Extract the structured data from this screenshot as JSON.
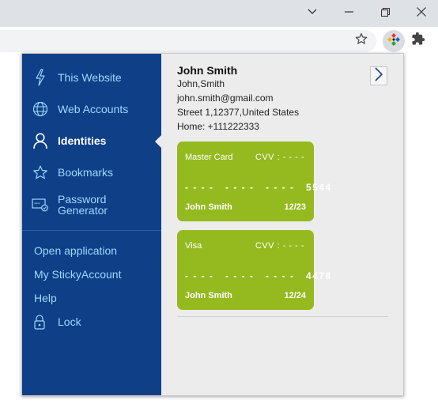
{
  "browser": {
    "window_controls": {
      "chevron": "chevron-down-icon",
      "minimize": "minimize-icon",
      "restore": "restore-icon",
      "close": "close-icon"
    },
    "toolbar": {
      "bookmark_icon": "star-icon",
      "extension_icon": "stickypassword-icon",
      "extensions_icon": "puzzle-icon"
    }
  },
  "popup": {
    "sidebar": {
      "items": [
        {
          "label": "This Website",
          "icon": "lightning-icon"
        },
        {
          "label": "Web Accounts",
          "icon": "globe-icon"
        },
        {
          "label": "Identities",
          "icon": "person-icon",
          "active": true
        },
        {
          "label": "Bookmarks",
          "icon": "star-icon"
        },
        {
          "label": "Password Generator",
          "line1": "Password",
          "line2": "Generator",
          "icon": "password-generator-icon"
        }
      ],
      "links": {
        "open_application": "Open application",
        "my_account": "My StickyAccount",
        "help": "Help",
        "lock": "Lock"
      }
    },
    "identity": {
      "name": "John Smith",
      "display_name": "John,Smith",
      "email": "john.smith@gmail.com",
      "address": "Street 1,12377,United States",
      "phone": "Home: +111222333"
    },
    "cards": [
      {
        "type": "Master Card",
        "cvv": "CVV : - - - -",
        "number": "- - - -   - - - -   - - - -   5544",
        "holder": "John Smith",
        "expiry": "12/23"
      },
      {
        "type": "Visa",
        "cvv": "CVV : - - - -",
        "number": "- - - -   - - - -   - - - -   4478",
        "holder": "John Smith",
        "expiry": "12/24"
      }
    ],
    "colors": {
      "sidebar": "#0f3f87",
      "card": "#95ba1f",
      "link": "#9fd8ff"
    }
  }
}
